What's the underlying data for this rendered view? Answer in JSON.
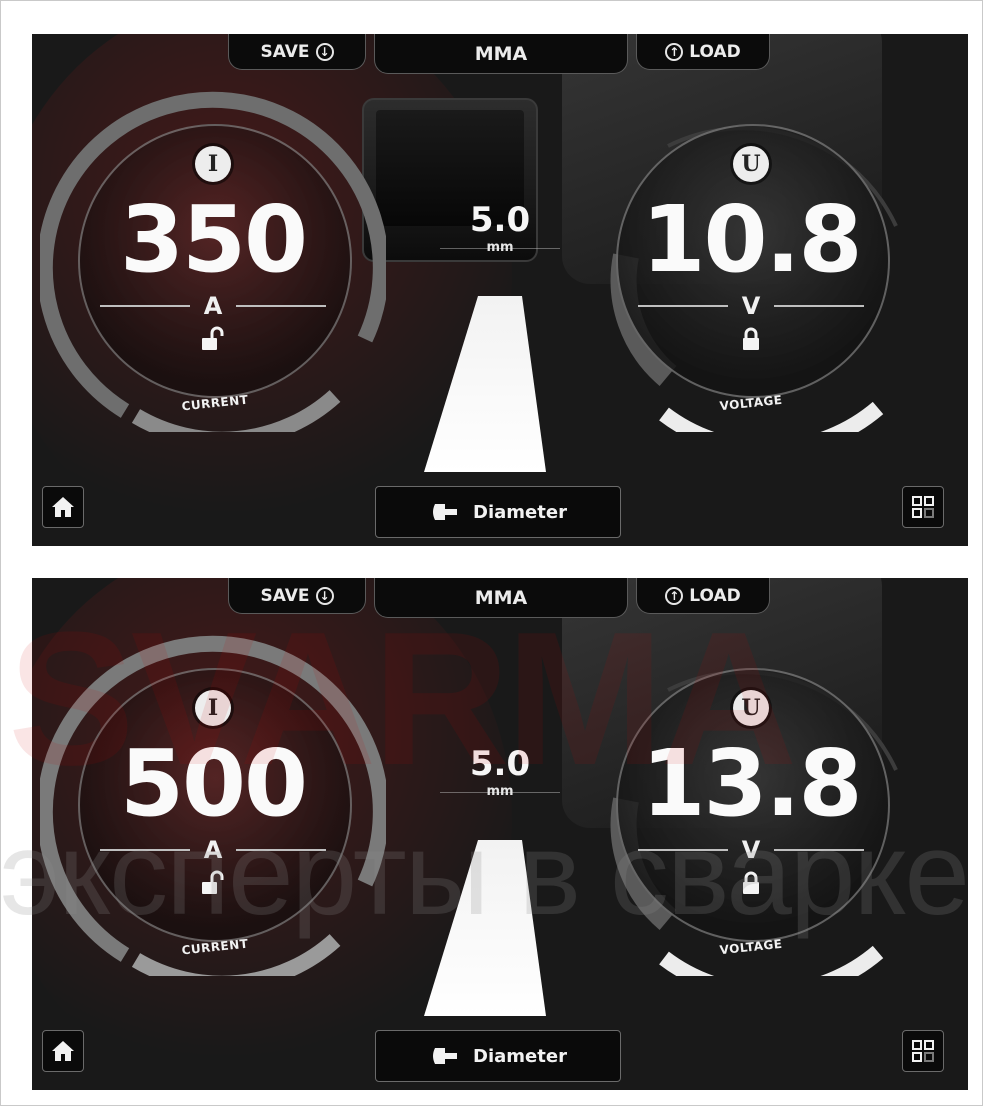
{
  "watermark": {
    "brand": "SVARMA",
    "slogan": "эксперты в сварке"
  },
  "colors": {
    "screen_bg": "#191919",
    "text": "#fafafa",
    "ring_active": "#e8e8e8",
    "ring_inactive": "#6e6e6e",
    "watermark_red": "#cd0000"
  },
  "screens": [
    {
      "top_bar": {
        "save_label": "SAVE",
        "mode_label": "MMA",
        "load_label": "LOAD"
      },
      "current": {
        "symbol": "I",
        "value": "350",
        "unit": "A",
        "label": "CURRENT",
        "lock_state": "unlocked",
        "lock_icon": "unlocked-padlock-icon"
      },
      "voltage": {
        "symbol": "U",
        "value": "10.8",
        "unit": "V",
        "label": "VOLTAGE",
        "lock_state": "locked",
        "lock_icon": "locked-padlock-icon"
      },
      "electrode": {
        "value": "5.0",
        "unit": "mm"
      },
      "bottom": {
        "diameter_label": "Diameter",
        "home_icon": "home-icon",
        "menu_icon": "grid-menu-icon"
      }
    },
    {
      "top_bar": {
        "save_label": "SAVE",
        "mode_label": "MMA",
        "load_label": "LOAD"
      },
      "current": {
        "symbol": "I",
        "value": "500",
        "unit": "A",
        "label": "CURRENT",
        "lock_state": "unlocked",
        "lock_icon": "unlocked-padlock-icon"
      },
      "voltage": {
        "symbol": "U",
        "value": "13.8",
        "unit": "V",
        "label": "VOLTAGE",
        "lock_state": "locked",
        "lock_icon": "locked-padlock-icon"
      },
      "electrode": {
        "value": "5.0",
        "unit": "mm"
      },
      "bottom": {
        "diameter_label": "Diameter",
        "home_icon": "home-icon",
        "menu_icon": "grid-menu-icon"
      }
    }
  ]
}
